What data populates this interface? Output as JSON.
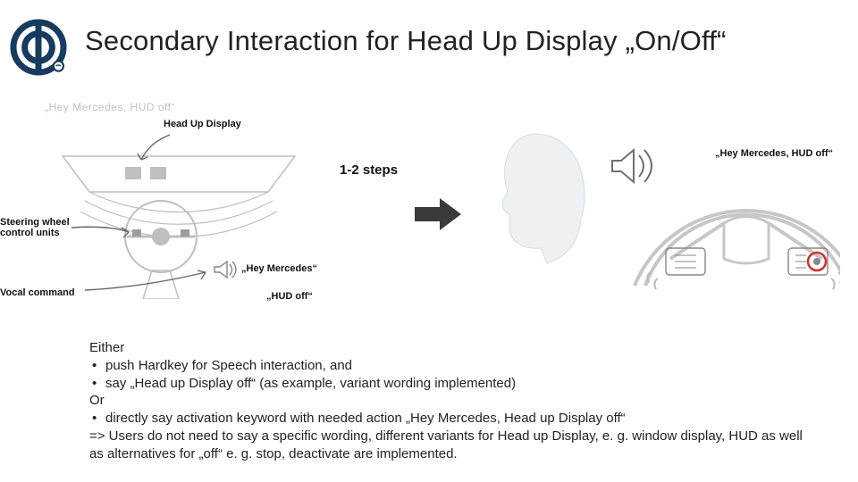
{
  "title": "Secondary Interaction for Head Up Display „On/Off“",
  "watermark": "„Hey Mercedes, HUD off“",
  "labels": {
    "hud": "Head Up Display",
    "steps": "1-2 steps",
    "swcu": "Steering wheel control units",
    "hey": "„Hey Mercedes“",
    "hud_off": "„HUD off“",
    "vocal": "Vocal command",
    "right_cmd": "„Hey Mercedes, HUD off“"
  },
  "body": {
    "either": "Either",
    "b1": "push Hardkey for Speech interaction, and",
    "b2": "say „Head up Display off“ (as example, variant wording implemented)",
    "or": "Or",
    "b3": "directly say activation keyword with needed action „Hey Mercedes, Head up Display off“",
    "conclusion": "=> Users do not need to say a specific wording, different variants for Head up Display, e. g. window display, HUD as well as alternatives for „off“ e. g. stop, deactivate are implemented."
  },
  "colors": {
    "logo": "#163b5e",
    "text": "#222222",
    "faint": "#b9c4cc",
    "gray": "#bfbfbf",
    "darkgray": "#777777",
    "arrow": "#3a3a3a"
  }
}
